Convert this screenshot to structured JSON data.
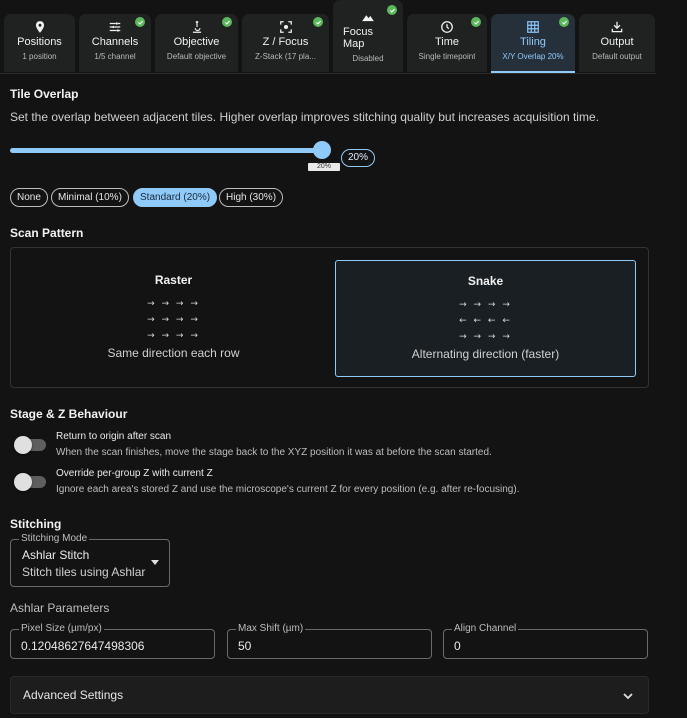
{
  "tabs": [
    {
      "label": "Positions",
      "sub": "1 position",
      "icon": "location-pin-icon",
      "done": false,
      "active": false
    },
    {
      "label": "Channels",
      "sub": "1/5 channel",
      "icon": "sliders-icon",
      "done": true,
      "active": false
    },
    {
      "label": "Objective",
      "sub": "Default objective",
      "icon": "microscope-icon",
      "done": true,
      "active": false
    },
    {
      "label": "Z / Focus",
      "sub": "Z-Stack (17 pla...",
      "icon": "focus-icon",
      "done": true,
      "active": false
    },
    {
      "label": "Focus Map",
      "sub": "Disabled",
      "icon": "mountain-icon",
      "done": true,
      "active": false
    },
    {
      "label": "Time",
      "sub": "Single timepoint",
      "icon": "clock-icon",
      "done": true,
      "active": false
    },
    {
      "label": "Tiling",
      "sub": "X/Y Overlap 20%",
      "icon": "grid-icon",
      "done": true,
      "active": true
    },
    {
      "label": "Output",
      "sub": "Default output",
      "icon": "download-icon",
      "done": false,
      "active": false
    }
  ],
  "tile_overlap": {
    "title": "Tile Overlap",
    "description": "Set the overlap between adjacent tiles. Higher overlap improves stitching quality but increases acquisition time.",
    "value_percent": 20,
    "value_label": "20%",
    "presets": [
      "None",
      "Minimal (10%)",
      "Standard (20%)",
      "High (30%)"
    ],
    "selected_preset": "Standard (20%)"
  },
  "scan_pattern": {
    "title": "Scan Pattern",
    "options": [
      {
        "name": "Raster",
        "rows": [
          "→ → → →",
          "→ → → →",
          "→ → → →"
        ],
        "description": "Same direction each row"
      },
      {
        "name": "Snake",
        "rows": [
          "→ → → →",
          "← ← ← ←",
          "→ → → →"
        ],
        "description": "Alternating direction (faster)"
      }
    ],
    "selected": "Snake"
  },
  "stage_z": {
    "title": "Stage & Z Behaviour",
    "toggles": [
      {
        "label": "Return to origin after scan",
        "description": "When the scan finishes, move the stage back to the XYZ position it was at before the scan started.",
        "on": false
      },
      {
        "label": "Override per-group Z with current Z",
        "description": "Ignore each area's stored Z and use the microscope's current Z for every position (e.g. after re-focusing).",
        "on": false
      }
    ]
  },
  "stitching": {
    "title": "Stitching",
    "mode_legend": "Stitching Mode",
    "mode_value": "Ashlar Stitch",
    "mode_sub": "Stitch tiles using Ashlar"
  },
  "ashlar": {
    "title": "Ashlar Parameters",
    "fields": [
      {
        "legend": "Pixel Size (µm/px)",
        "value": "0.12048627647498306"
      },
      {
        "legend": "Max Shift (µm)",
        "value": "50"
      },
      {
        "legend": "Align Channel",
        "value": "0"
      }
    ]
  },
  "advanced": {
    "label": "Advanced Settings"
  },
  "colors": {
    "accent": "#90caf9",
    "check": "#5cb85c",
    "background": "#131313"
  }
}
